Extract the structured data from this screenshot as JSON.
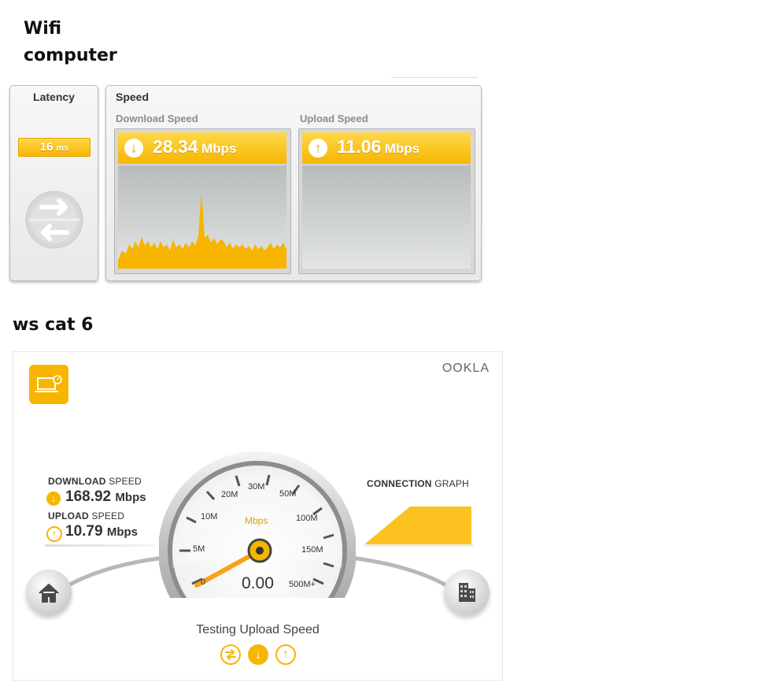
{
  "headings": {
    "line1": "Wifi",
    "line2": "computer",
    "line3": "ws cat 6"
  },
  "top_panel": {
    "latency": {
      "title": "Latency",
      "value": "16",
      "unit": "ms",
      "icon": "latency-arrows-icon"
    },
    "speed": {
      "title": "Speed",
      "download": {
        "label": "Download Speed",
        "value": "28.34",
        "unit": "Mbps",
        "icon": "arrow-down-icon"
      },
      "upload": {
        "label": "Upload Speed",
        "value": "11.06",
        "unit": "Mbps",
        "icon": "arrow-up-icon"
      }
    },
    "accent_color": "#f7b500"
  },
  "ookla": {
    "brand": "OOKLA",
    "app_icon": "laptop-speedometer-icon",
    "download": {
      "label_bold": "DOWNLOAD",
      "label_rest": " SPEED",
      "value": "168.92",
      "unit": "Mbps",
      "icon": "arrow-down-icon"
    },
    "upload": {
      "label_bold": "UPLOAD",
      "label_rest": " SPEED",
      "value": "10.79",
      "unit": "Mbps",
      "icon": "arrow-up-icon"
    },
    "graph": {
      "label_bold": "CONNECTION",
      "label_rest": " GRAPH"
    },
    "gauge": {
      "unit_label": "Mbps",
      "reading": "0.00",
      "ticks": [
        "0",
        "5M",
        "10M",
        "20M",
        "30M",
        "50M",
        "100M",
        "150M",
        "500M+"
      ]
    },
    "status": "Testing Upload Speed",
    "home_icon": "home-icon",
    "server_icon": "building-icon",
    "step_icons": [
      "ping-icon",
      "download-step-icon",
      "upload-step-icon"
    ]
  }
}
